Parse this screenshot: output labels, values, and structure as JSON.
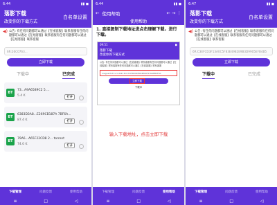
{
  "app": {
    "title": "落影下载",
    "subtitle": "改变你的下载方式",
    "settings_label": "白名单设置"
  },
  "status": {
    "time_left": "6:44",
    "time_right": "6:47",
    "battery": "90"
  },
  "notice": "公告: 有任何问题都可以通过【在线客服】联系客服有任何问题都可以通过【在线客服】联系客服有任何问题都可以通过【在线客服】联系客服",
  "url_text": "6R:26C0763...",
  "url_text_right": "6R:C3EFCD3F13A0C5F83E4982E9B3D9905EFB4B5",
  "download_button": "立即下载",
  "tabs": {
    "downloading": "下载中",
    "completed": "已完成"
  },
  "files": [
    {
      "icon": "BT",
      "name": "73...A9A6589C2 5....",
      "size": "5.4 K",
      "open": "打开"
    },
    {
      "icon": "BT",
      "name": "6383D3A8...E269CB187A 7BF6A...",
      "size": "87.4 K",
      "open": "打开"
    },
    {
      "icon": "BT",
      "name": "79A6...A65F22CD8 2... torrent",
      "size": "74.0 K",
      "open": "打开"
    }
  ],
  "bottom_nav": [
    "下载管理",
    "问题反馈",
    "使用帮助"
  ],
  "help": {
    "back": "←",
    "title": "使用帮助",
    "center_title": "使用帮助",
    "step1": "1. 直接复制下载地址进点击理解下载，进行下载。",
    "inner_time": "09:51",
    "inner_url": "magnet?xt=urn:btih:3CC71E3D0485D4E60F1FA0EB4F6C",
    "inner_button": "立即下载",
    "inner_tab": "下载中",
    "instruction": "输入下载地址，点击立即下载"
  }
}
